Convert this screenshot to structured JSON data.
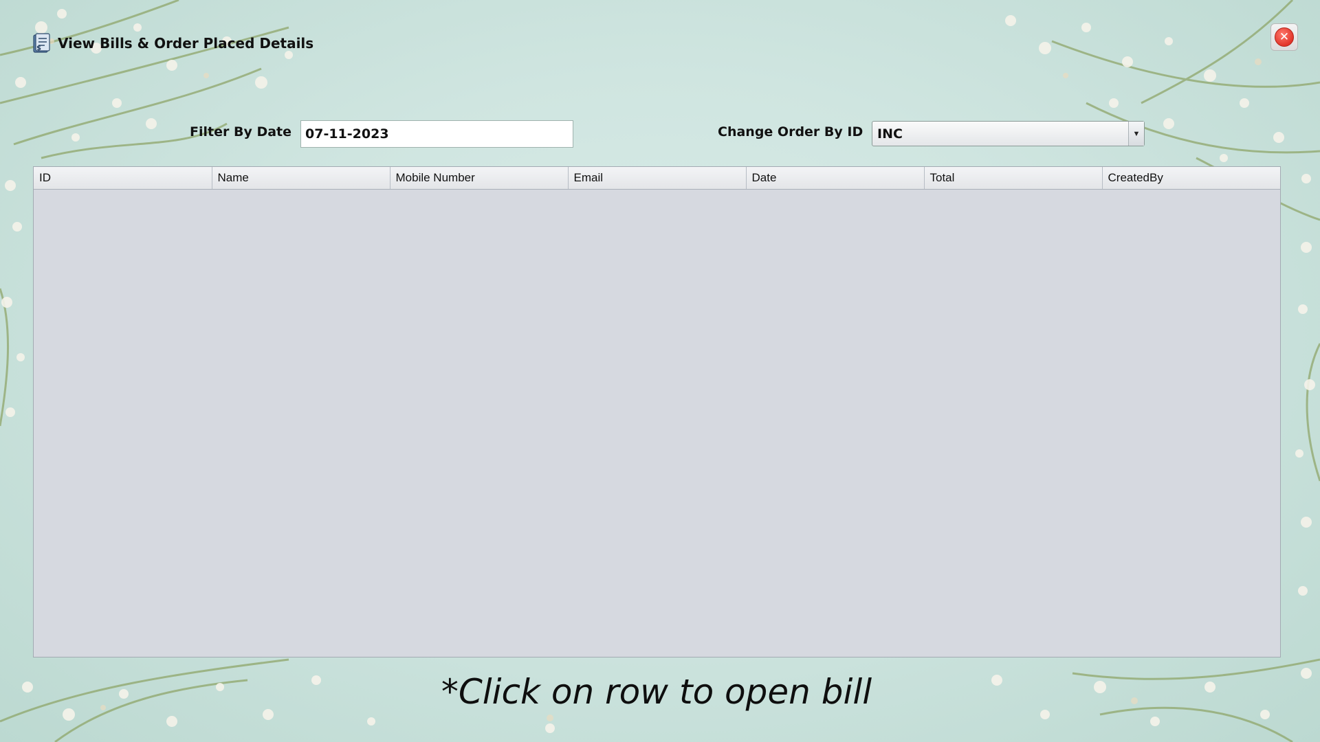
{
  "window": {
    "title": "View Bills & Order Placed Details",
    "title_icon": "document-icon",
    "close_icon": "close-icon"
  },
  "filter": {
    "label": "Filter By Date",
    "value": "07-11-2023"
  },
  "order": {
    "label": "Change Order By ID",
    "selected": "INC"
  },
  "table": {
    "columns": [
      "ID",
      "Name",
      "Mobile Number",
      "Email",
      "Date",
      "Total",
      "CreatedBy"
    ],
    "rows": []
  },
  "hint": "*Click on row to open bill",
  "colors": {
    "background": "#cfe6e1",
    "table_body": "#d6d9e0",
    "close_red": "#e2352a"
  }
}
